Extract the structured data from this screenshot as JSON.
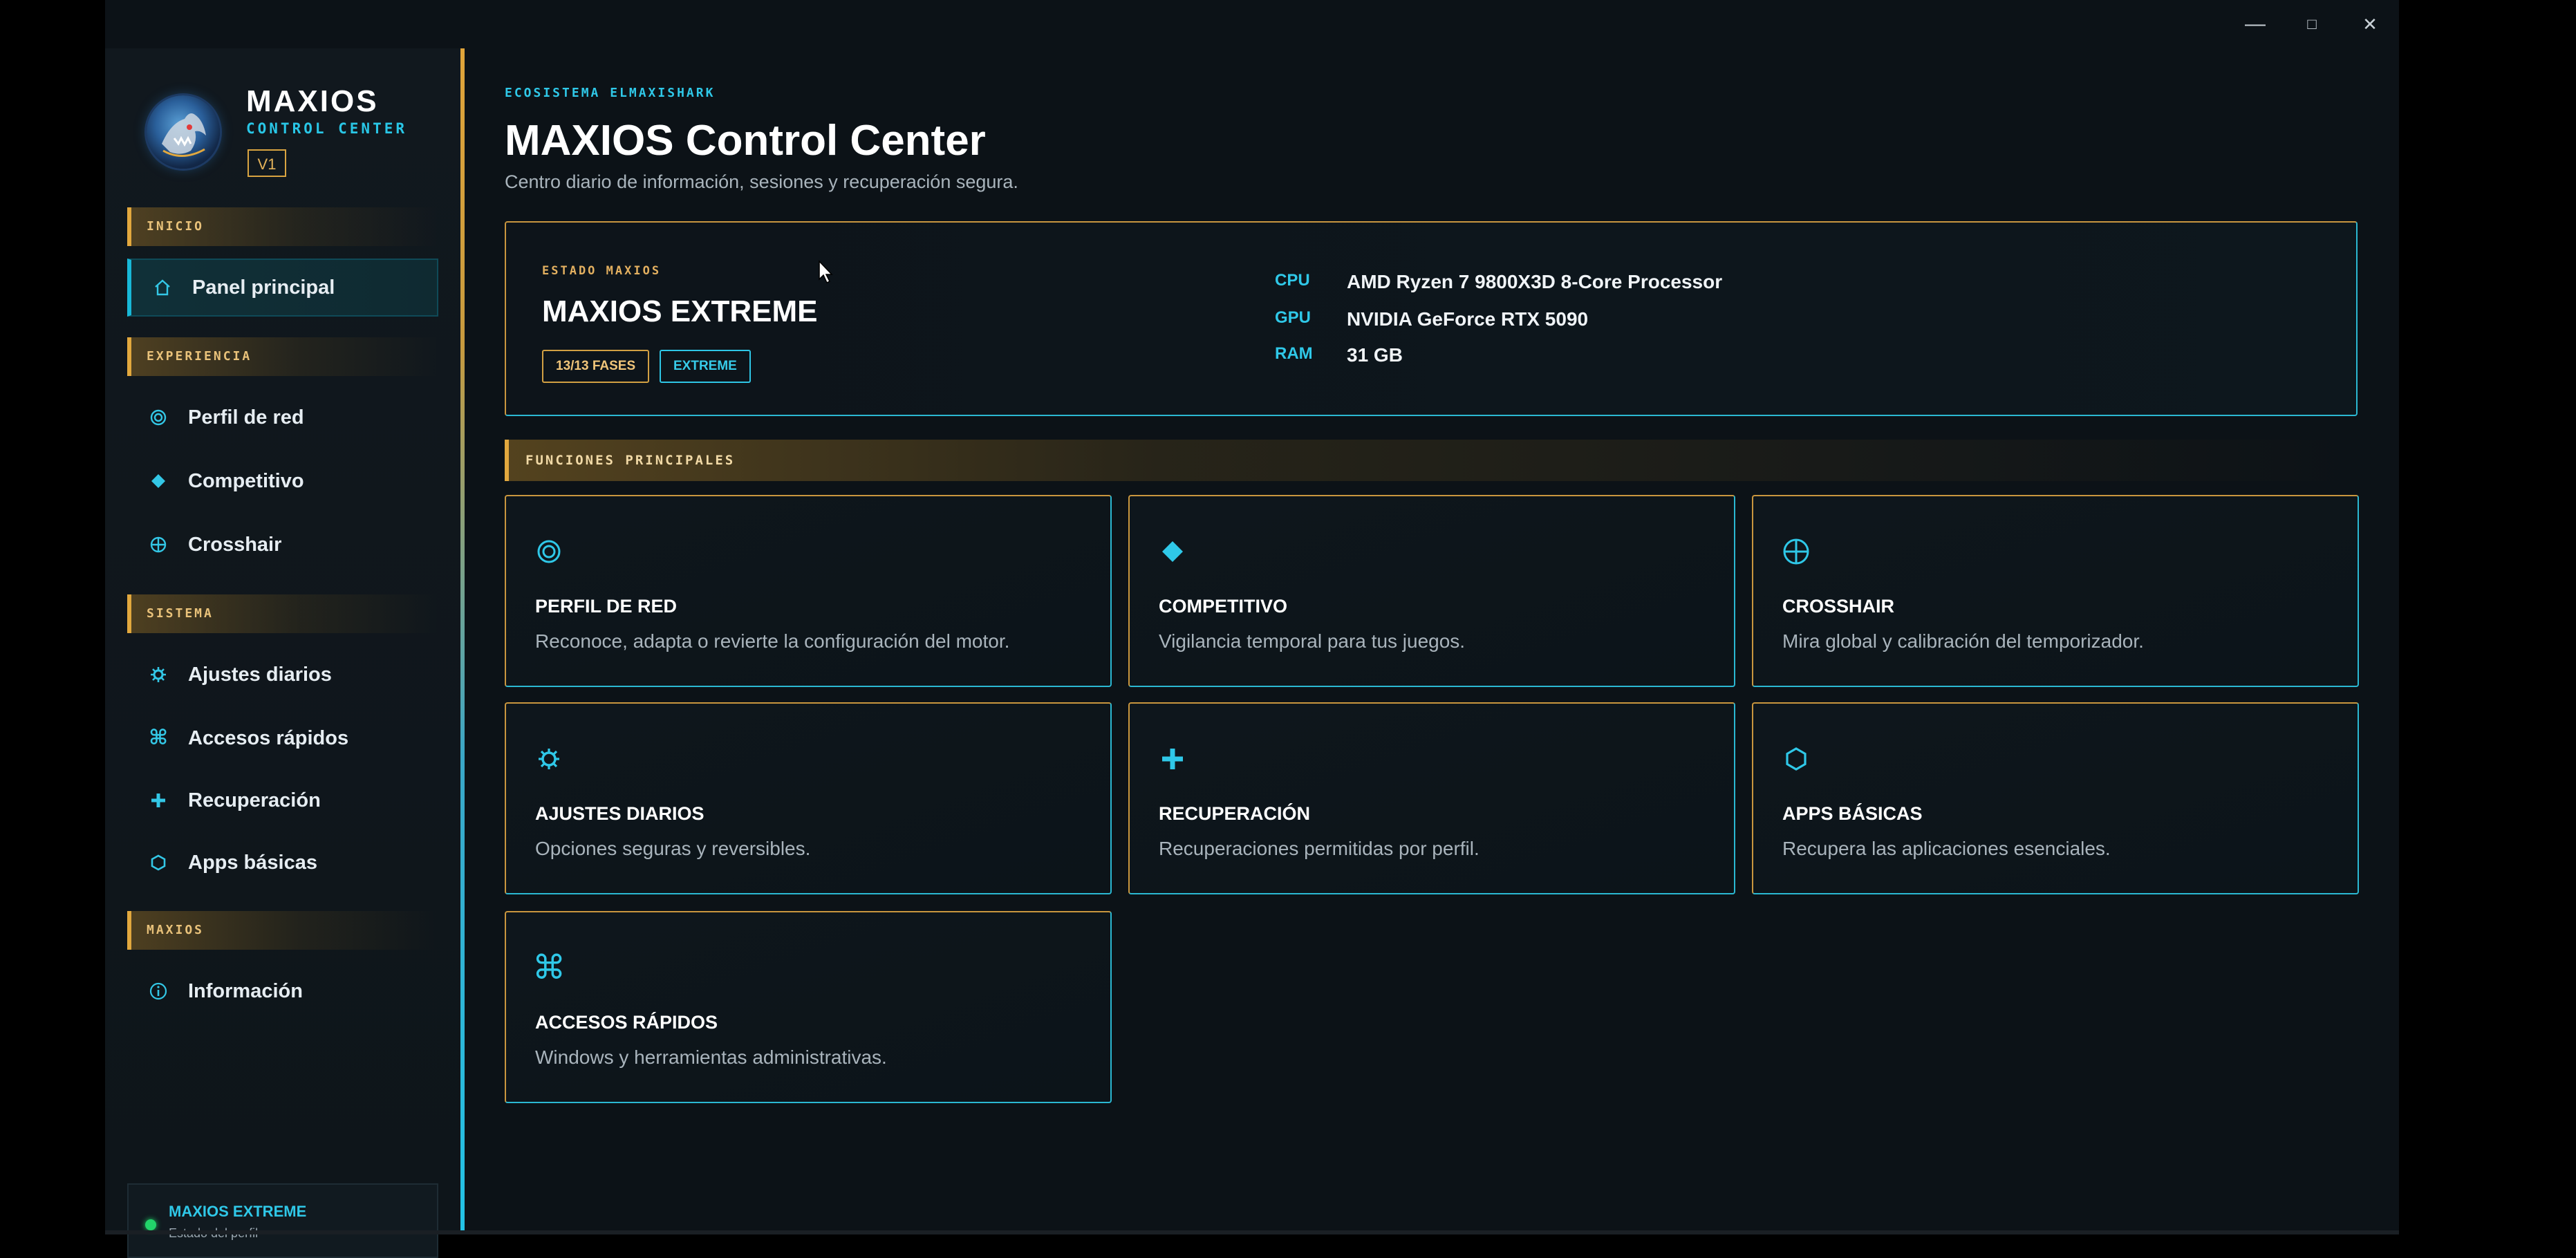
{
  "window": {
    "minimize": "—",
    "maximize": "□",
    "close": "✕"
  },
  "brand": {
    "title": "MAXIOS",
    "subtitle": "CONTROL CENTER",
    "version": "V1",
    "logo_icon": "shark-logo"
  },
  "sidebar": {
    "sections": [
      {
        "label": "INICIO",
        "items": [
          {
            "label": "Panel principal",
            "icon": "home-icon",
            "active": true
          }
        ]
      },
      {
        "label": "EXPERIENCIA",
        "items": [
          {
            "label": "Perfil de red",
            "icon": "network-target-icon"
          },
          {
            "label": "Competitivo",
            "icon": "diamond-icon"
          },
          {
            "label": "Crosshair",
            "icon": "crosshair-icon"
          }
        ]
      },
      {
        "label": "SISTEMA",
        "items": [
          {
            "label": "Ajustes diarios",
            "icon": "gear-icon"
          },
          {
            "label": "Accesos rápidos",
            "icon": "command-icon"
          },
          {
            "label": "Recuperación",
            "icon": "plus-icon"
          },
          {
            "label": "Apps básicas",
            "icon": "hexagon-icon"
          }
        ]
      },
      {
        "label": "MAXIOS",
        "items": [
          {
            "label": "Información",
            "icon": "info-icon"
          }
        ]
      }
    ],
    "status": {
      "title": "MAXIOS EXTREME",
      "subtitle": "Estado del perfil",
      "color": "#22d46a"
    }
  },
  "header": {
    "eyebrow": "ECOSISTEMA ELMAXISHARK",
    "title": "MAXIOS Control Center",
    "subtitle": "Centro diario de información, sesiones y recuperación segura."
  },
  "hero": {
    "eyebrow": "ESTADO MAXIOS",
    "title": "MAXIOS EXTREME",
    "badges": [
      "13/13 FASES",
      "EXTREME"
    ],
    "specs": [
      {
        "key": "CPU",
        "value": "AMD Ryzen 7 9800X3D 8-Core Processor"
      },
      {
        "key": "GPU",
        "value": "NVIDIA GeForce RTX 5090"
      },
      {
        "key": "RAM",
        "value": "31 GB"
      }
    ]
  },
  "functions": {
    "heading": "FUNCIONES PRINCIPALES",
    "cards": [
      {
        "title": "PERFIL DE RED",
        "desc": "Reconoce, adapta o revierte la configuración del motor.",
        "icon": "network-target-icon"
      },
      {
        "title": "COMPETITIVO",
        "desc": "Vigilancia temporal para tus juegos.",
        "icon": "diamond-icon"
      },
      {
        "title": "CROSSHAIR",
        "desc": "Mira global y calibración del temporizador.",
        "icon": "crosshair-icon"
      },
      {
        "title": "AJUSTES DIARIOS",
        "desc": "Opciones seguras y reversibles.",
        "icon": "gear-icon"
      },
      {
        "title": "RECUPERACIÓN",
        "desc": "Recuperaciones permitidas por perfil.",
        "icon": "plus-icon"
      },
      {
        "title": "APPS BÁSICAS",
        "desc": "Recupera las aplicaciones esenciales.",
        "icon": "hexagon-icon"
      },
      {
        "title": "ACCESOS RÁPIDOS",
        "desc": "Windows y herramientas administrativas.",
        "icon": "command-icon"
      }
    ]
  },
  "colors": {
    "accent_cyan": "#2fc8e8",
    "accent_gold": "#e2a83e",
    "background": "#0c1217"
  }
}
